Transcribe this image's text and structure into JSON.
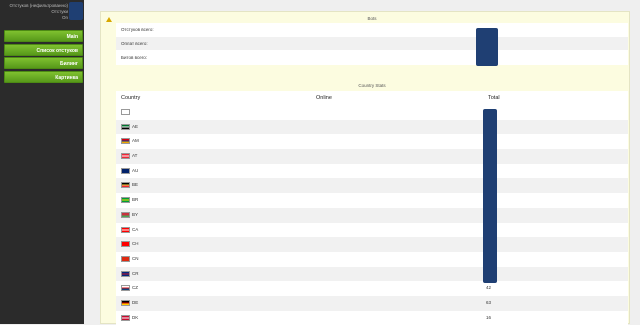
{
  "sidebar": {
    "user_line1": "Отстуков (нефильтрованно)",
    "user_line2": "Отстуки",
    "user_line3": "On",
    "menu": [
      {
        "label": "Main"
      },
      {
        "label": "Список отстуков"
      },
      {
        "label": "Билинг"
      },
      {
        "label": "Картинка"
      }
    ]
  },
  "bots": {
    "title": "Bots",
    "rows": [
      {
        "label": "Отстуков всего:"
      },
      {
        "label": "Оплат всего:"
      },
      {
        "label": "Битов всего:"
      }
    ]
  },
  "country_stats": {
    "title": "Country Stats",
    "columns": {
      "country": "Country",
      "online": "Online",
      "total": "Total"
    },
    "rows": [
      {
        "code": "",
        "total": "",
        "flag": "unknown-flag-icon",
        "colors": [
          "#ffffff",
          "#ffffff",
          "#ffffff"
        ]
      },
      {
        "code": "AE",
        "total": "",
        "flag": "ae-flag-icon",
        "colors": [
          "#00732f",
          "#ffffff",
          "#000000"
        ]
      },
      {
        "code": "AM",
        "total": "",
        "flag": "am-flag-icon",
        "colors": [
          "#d90012",
          "#0033a0",
          "#f2a800"
        ]
      },
      {
        "code": "AT",
        "total": "",
        "flag": "at-flag-icon",
        "colors": [
          "#ed2939",
          "#ffffff",
          "#ed2939"
        ]
      },
      {
        "code": "AU",
        "total": "",
        "flag": "au-flag-icon",
        "colors": [
          "#012169",
          "#012169",
          "#012169"
        ]
      },
      {
        "code": "BE",
        "total": "",
        "flag": "be-flag-icon",
        "colors": [
          "#000000",
          "#fae042",
          "#ed2939"
        ]
      },
      {
        "code": "BR",
        "total": "",
        "flag": "br-flag-icon",
        "colors": [
          "#009c3b",
          "#ffdf00",
          "#009c3b"
        ]
      },
      {
        "code": "BY",
        "total": "",
        "flag": "by-flag-icon",
        "colors": [
          "#c8313e",
          "#c8313e",
          "#4aa657"
        ]
      },
      {
        "code": "CA",
        "total": "",
        "flag": "ca-flag-icon",
        "colors": [
          "#ff0000",
          "#ffffff",
          "#ff0000"
        ]
      },
      {
        "code": "CH",
        "total": "",
        "flag": "ch-flag-icon",
        "colors": [
          "#ff0000",
          "#ff0000",
          "#ff0000"
        ]
      },
      {
        "code": "CN",
        "total": "",
        "flag": "cn-flag-icon",
        "colors": [
          "#de2910",
          "#de2910",
          "#de2910"
        ]
      },
      {
        "code": "CR",
        "total": "",
        "flag": "cr-flag-icon",
        "colors": [
          "#002b7f",
          "#ce1126",
          "#002b7f"
        ]
      },
      {
        "code": "CZ",
        "total": "42",
        "flag": "cz-flag-icon",
        "colors": [
          "#ffffff",
          "#d7141a",
          "#11457e"
        ]
      },
      {
        "code": "DE",
        "total": "63",
        "flag": "de-flag-icon",
        "colors": [
          "#000000",
          "#dd0000",
          "#ffce00"
        ]
      },
      {
        "code": "DK",
        "total": "16",
        "flag": "dk-flag-icon",
        "colors": [
          "#c60c30",
          "#ffffff",
          "#c60c30"
        ]
      }
    ]
  }
}
